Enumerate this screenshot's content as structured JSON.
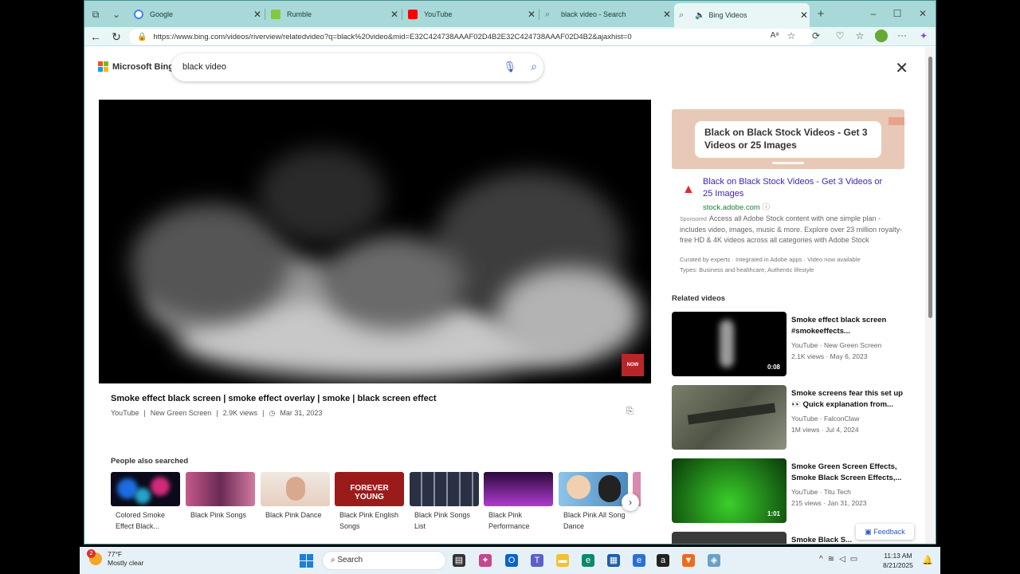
{
  "tabs": [
    {
      "title": "Google",
      "icon": "google-icon",
      "color": "#4285f4"
    },
    {
      "title": "Rumble",
      "icon": "rumble-icon",
      "color": "#85c742"
    },
    {
      "title": "YouTube",
      "icon": "youtube-icon",
      "color": "#ff0000"
    },
    {
      "title": "black video - Search",
      "icon": "search-icon",
      "color": "#3a7a7a"
    },
    {
      "title": "Bing Videos",
      "icon": "search-icon",
      "color": "#3a7a7a"
    }
  ],
  "address": {
    "url": "https://www.bing.com/videos/riverview/relatedvideo?q=black%20video&mid=E32C424738AAAF02D4B2E32C424738AAAF02D4B2&ajaxhist=0"
  },
  "bing": {
    "logo_text": "Microsoft Bing",
    "query": "black video"
  },
  "video": {
    "title": "Smoke effect black screen | smoke effect overlay | smoke | black screen effect",
    "source": "YouTube",
    "channel": "New Green Screen",
    "views": "2.9K views",
    "date": "Mar 31, 2023",
    "badge": "NOW"
  },
  "people_also_searched": {
    "heading": "People also searched",
    "items": [
      {
        "label": "Colored Smoke Effect Black...",
        "thumb_text": ""
      },
      {
        "label": "Black Pink Songs",
        "thumb_text": ""
      },
      {
        "label": "Black Pink Dance",
        "thumb_text": ""
      },
      {
        "label": "Black Pink English Songs",
        "thumb_text": "FOREVER YOUNG"
      },
      {
        "label": "Black Pink Songs List",
        "thumb_text": ""
      },
      {
        "label": "Black Pink Performance",
        "thumb_text": ""
      },
      {
        "label": "Black Pink All Song Dance",
        "thumb_text": ""
      }
    ]
  },
  "ad": {
    "banner_text": "Black on Black Stock Videos - Get 3 Videos or 25 Images",
    "headline": "Black on Black Stock Videos - Get 3 Videos or 25 Images",
    "domain": "stock.adobe.com",
    "sponsored": "Sponsored",
    "body": "Access all Adobe Stock content with one simple plan - includes video, images, music & more. Explore over 23 million royalty-free HD & 4K videos across all categories with Adobe Stock",
    "sub1": "Curated by experts · Integrated in Adobe apps · Video now available",
    "sub2": "Types: Business and healthcare, Authentic lifestyle"
  },
  "related": {
    "heading": "Related videos",
    "items": [
      {
        "title": "Smoke effect black screen #smokeeffects...",
        "source": "YouTube · New Green Screen",
        "meta": "2.1K views · May 6, 2023",
        "duration": "0:08"
      },
      {
        "title": "Smoke screens fear this set up 👀 Quick explanation from...",
        "source": "YouTube · FalconClaw",
        "meta": "1M views · Jul 4, 2024",
        "duration": ""
      },
      {
        "title": "Smoke Green Screen Effects, Smoke Black Screen Effects,...",
        "source": "YouTube · Titu Tech",
        "meta": "215 views · Jan 31, 2023",
        "duration": "1:01"
      },
      {
        "title": "Smoke Black S...",
        "source": "",
        "meta": "",
        "duration": ""
      }
    ]
  },
  "feedback": "Feedback",
  "taskbar": {
    "temp": "77°F",
    "weather": "Mostly clear",
    "notif_count": "2",
    "search": "Search",
    "time": "11:13 AM",
    "date": "8/21/2025"
  }
}
